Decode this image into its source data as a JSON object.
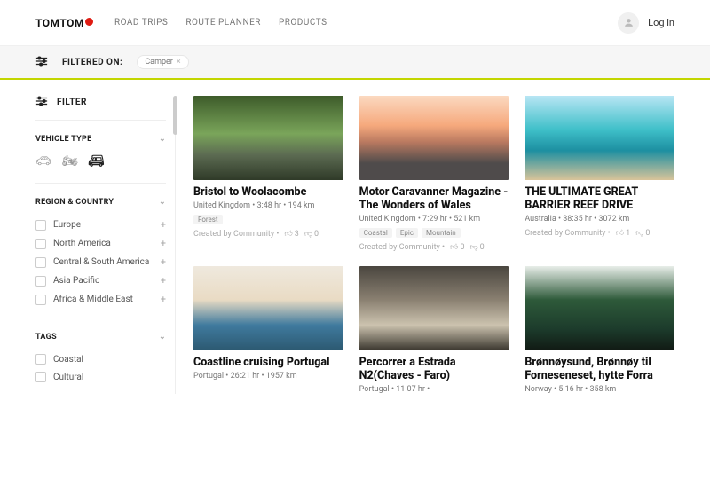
{
  "header": {
    "logo_text": "TOMTOM",
    "nav": [
      "ROAD TRIPS",
      "ROUTE PLANNER",
      "PRODUCTS"
    ],
    "login_label": "Log in"
  },
  "filterbar": {
    "label": "FILTERED ON:",
    "chips": [
      "Camper"
    ]
  },
  "sidebar": {
    "filter_label": "FILTER",
    "vehicle": {
      "heading": "VEHICLE TYPE",
      "options": [
        "car",
        "motorcycle",
        "camper"
      ],
      "selected": "camper"
    },
    "region": {
      "heading": "REGION & COUNTRY",
      "items": [
        "Europe",
        "North America",
        "Central & South America",
        "Asia Pacific",
        "Africa & Middle East"
      ]
    },
    "tags": {
      "heading": "TAGS",
      "items": [
        "Coastal",
        "Cultural"
      ]
    }
  },
  "cards": [
    {
      "title": "Bristol to Woolacombe",
      "meta": "United Kingdom  •  3:48 hr  •  194 km",
      "tags": [
        "Forest"
      ],
      "byline": "Created by Community  •",
      "up": "3",
      "down": "0",
      "thumb_class": "img-forest"
    },
    {
      "title": "Motor Caravanner Magazine - The Wonders of Wales",
      "meta": "United Kingdom  •  7:29 hr  •  521 km",
      "tags": [
        "Coastal",
        "Epic",
        "Mountain"
      ],
      "byline": "Created by Community  •",
      "up": "0",
      "down": "0",
      "thumb_class": "img-cardiff"
    },
    {
      "title": "THE ULTIMATE GREAT BARRIER REEF DRIVE",
      "meta": "Australia  •  38:35 hr  •  3072 km",
      "tags": [],
      "byline": "Created by Community  •",
      "up": "1",
      "down": "0",
      "thumb_class": "img-reef"
    },
    {
      "title": "Coastline cruising Portugal",
      "meta": "Portugal  •  26:21 hr  •  1957 km",
      "tags": [],
      "byline": "",
      "up": "",
      "down": "",
      "thumb_class": "img-portugal"
    },
    {
      "title": "Percorrer a Estrada N2(Chaves - Faro)",
      "meta": "Portugal  •  11:07 hr  •  ",
      "tags": [],
      "byline": "",
      "up": "",
      "down": "",
      "thumb_class": "img-estrada"
    },
    {
      "title": "Brønnøysund, Brønnøy til Forneseneset, hytte Forra",
      "meta": "Norway  •  5:16 hr  •  358 km",
      "tags": [],
      "byline": "",
      "up": "",
      "down": "",
      "thumb_class": "img-norway"
    }
  ]
}
